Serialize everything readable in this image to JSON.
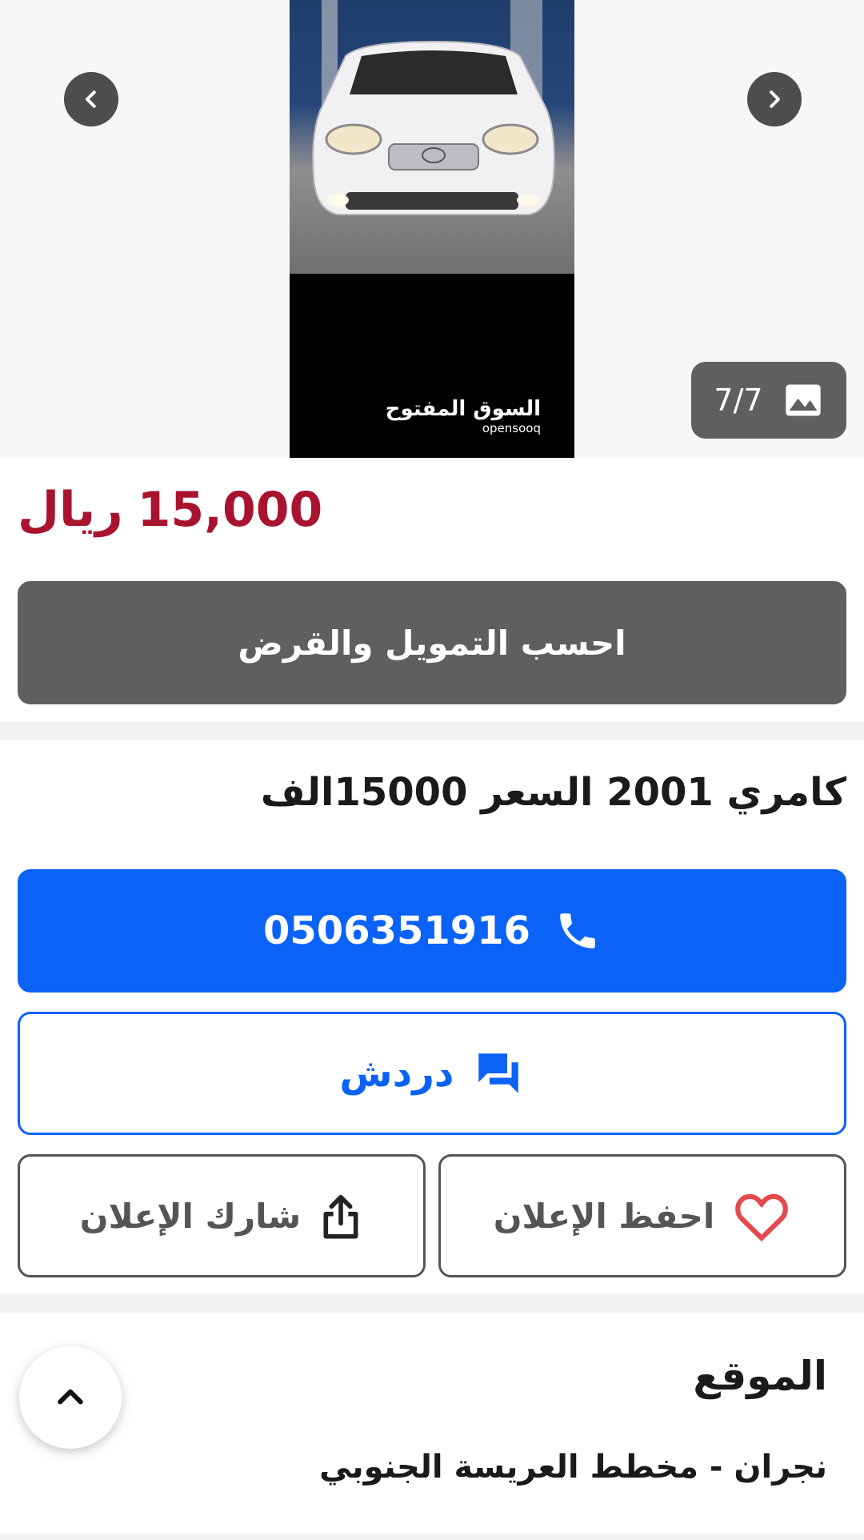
{
  "gallery": {
    "counter": "7/7",
    "watermark_ar": "السوق المفتوح",
    "watermark_en": "opensooq",
    "icons": {
      "prev": "chevron-left-icon",
      "next": "chevron-right-icon",
      "image": "image-icon"
    }
  },
  "listing": {
    "price_amount": "15,000",
    "price_currency": "ريال",
    "loan_button": "احسب التمويل والقرض",
    "title": "كامري 2001 السعر 15000الف"
  },
  "actions": {
    "phone": "0506351916",
    "chat": "دردش",
    "save": "احفظ الإعلان",
    "share": "شارك الإعلان"
  },
  "location": {
    "heading": "الموقع",
    "value": "نجران - مخطط العريسة الجنوبي"
  },
  "colors": {
    "price": "#a9132d",
    "primary": "#0a62f7",
    "dark_button": "#5f5f5f",
    "heart": "#e5484d"
  }
}
